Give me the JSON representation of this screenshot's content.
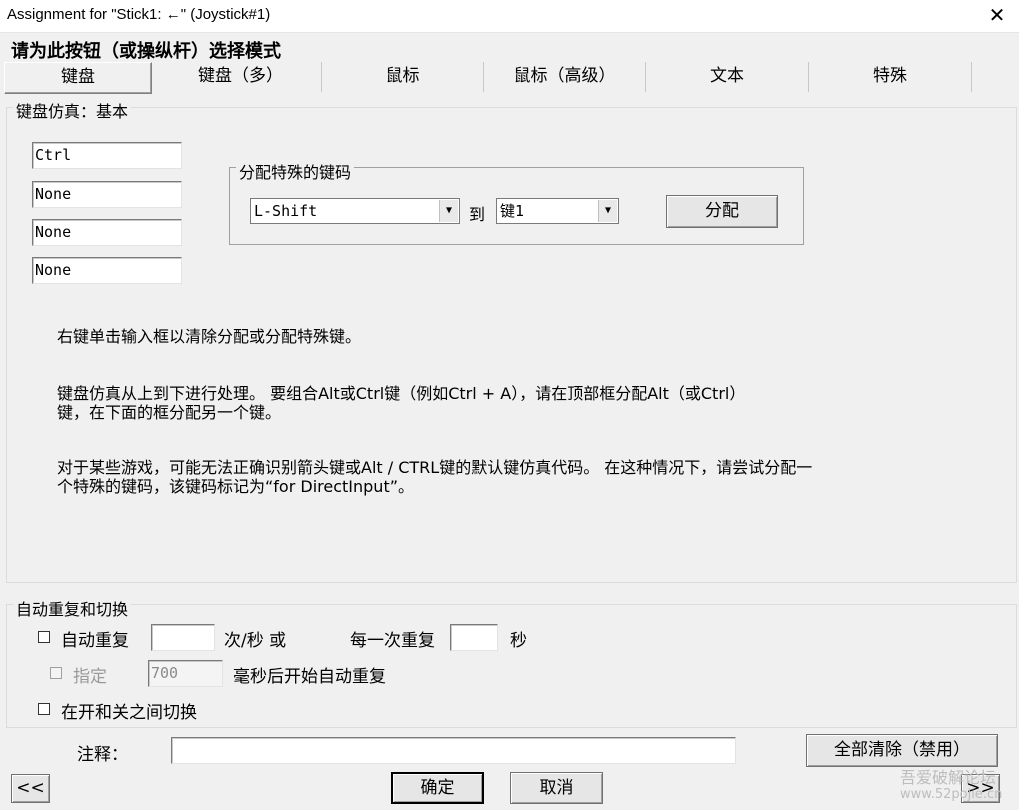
{
  "window": {
    "title": "Assignment for \"Stick1: ←\" (Joystick#1)",
    "close_glyph": "✕"
  },
  "heading": "请为此按钮（或操纵杆）选择模式",
  "tabs": [
    {
      "label": "键盘",
      "active": true
    },
    {
      "label": "键盘（多）",
      "active": false
    },
    {
      "label": "鼠标",
      "active": false
    },
    {
      "label": "鼠标（高级）",
      "active": false
    },
    {
      "label": "文本",
      "active": false
    },
    {
      "label": "特殊",
      "active": false
    }
  ],
  "keyboard_group": {
    "legend": "键盘仿真：基本",
    "keys": [
      "Ctrl",
      "None",
      "None",
      "None"
    ],
    "special": {
      "legend": "分配特殊的键码",
      "key_select": "L-Shift",
      "to_label": "到",
      "slot_select": "键1",
      "assign_button": "分配"
    },
    "info": [
      [
        "右键单击输入框以清除分配或分配特殊键。"
      ],
      [
        "键盘仿真从上到下进行处理。 要组合Alt或Ctrl键（例如Ctrl + A），请在顶部框分配Alt（或Ctrl）",
        "键，在下面的框分配另一个键。"
      ],
      [
        "对于某些游戏，可能无法正确识别箭头键或Alt / CTRL键的默认键仿真代码。 在这种情况下，请尝试分配一",
        "个特殊的键码，该键码标记为“for DirectInput”。"
      ]
    ]
  },
  "repeat_group": {
    "legend": "自动重复和切换",
    "auto_repeat_label": "自动重复",
    "auto_repeat_rate": "",
    "per_sec_or": "次/秒 或",
    "every_label": "每一次重复",
    "every_value": "",
    "sec_label": "秒",
    "specify_label": "指定",
    "delay_value": "700",
    "delay_suffix": "毫秒后开始自动重复",
    "toggle_label": "在开和关之间切换"
  },
  "comment": {
    "label": "注释：",
    "value": ""
  },
  "buttons": {
    "clear_all": "全部清除（禁用）",
    "prev": "<<",
    "ok": "确定",
    "cancel": "取消",
    "next": ">>"
  },
  "watermark": {
    "line1": "吾爱破解论坛",
    "line2": "www.52pojie.cn"
  }
}
